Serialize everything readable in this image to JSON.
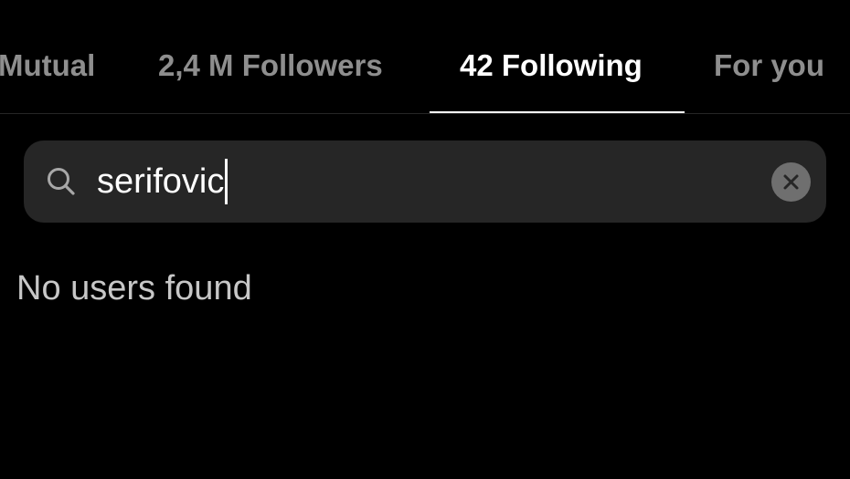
{
  "tabs": [
    {
      "label": "Mutual",
      "active": false
    },
    {
      "label": "2,4 M Followers",
      "active": false
    },
    {
      "label": "42 Following",
      "active": true
    },
    {
      "label": "For you",
      "active": false
    }
  ],
  "search": {
    "value": "serifovic",
    "icon": "search-icon",
    "clear_icon": "close-icon"
  },
  "results": {
    "empty_message": "No users found"
  },
  "colors": {
    "background": "#000000",
    "search_field": "#262626",
    "inactive_tab": "#8e8e8e",
    "active_tab": "#ffffff"
  }
}
